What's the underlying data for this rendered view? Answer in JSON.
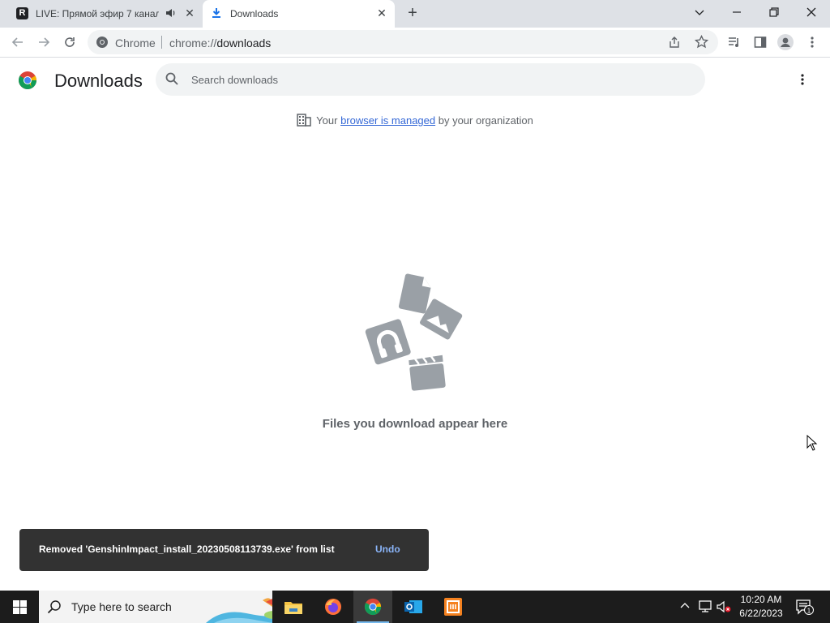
{
  "tabs": [
    {
      "title": "LIVE: Прямой эфир 7 канал",
      "favicon": "R",
      "audio": true
    },
    {
      "title": "Downloads",
      "active": true
    }
  ],
  "toolbar": {
    "site_chip": "Chrome",
    "url_prefix": "chrome://",
    "url_host": "downloads"
  },
  "page": {
    "title": "Downloads",
    "search_placeholder": "Search downloads",
    "managed_prefix": "Your ",
    "managed_link": "browser is managed",
    "managed_suffix": " by your organization",
    "empty_message": "Files you download appear here"
  },
  "snackbar": {
    "message": "Removed 'GenshinImpact_install_20230508113739.exe' from list",
    "action": "Undo"
  },
  "taskbar": {
    "search_placeholder": "Type here to search",
    "time": "10:20 AM",
    "date": "6/22/2023",
    "notification_count": "1"
  },
  "colors": {
    "accent": "#1a73e8",
    "link": "#3367d6",
    "snackbar_bg": "#323232",
    "snackbar_action": "#8ab4f8",
    "taskbar_bg": "#1c1c1c"
  },
  "icons": [
    "r-app-icon",
    "audio-icon",
    "close-icon",
    "download-icon",
    "plus-icon",
    "chevron-down-icon",
    "minimize-icon",
    "restore-icon",
    "back-icon",
    "forward-icon",
    "reload-icon",
    "chrome-icon",
    "share-icon",
    "star-icon",
    "media-icon",
    "side-panel-icon",
    "profile-icon",
    "kebab-icon",
    "search-icon",
    "building-icon",
    "file-icon",
    "image-icon",
    "audio-file-icon",
    "video-icon",
    "windows-start-icon",
    "file-explorer-icon",
    "firefox-icon",
    "chrome-taskbar-icon",
    "outlook-icon",
    "app-icon",
    "chevron-up-icon",
    "network-icon",
    "volume-muted-icon",
    "notification-icon",
    "cursor-icon"
  ]
}
